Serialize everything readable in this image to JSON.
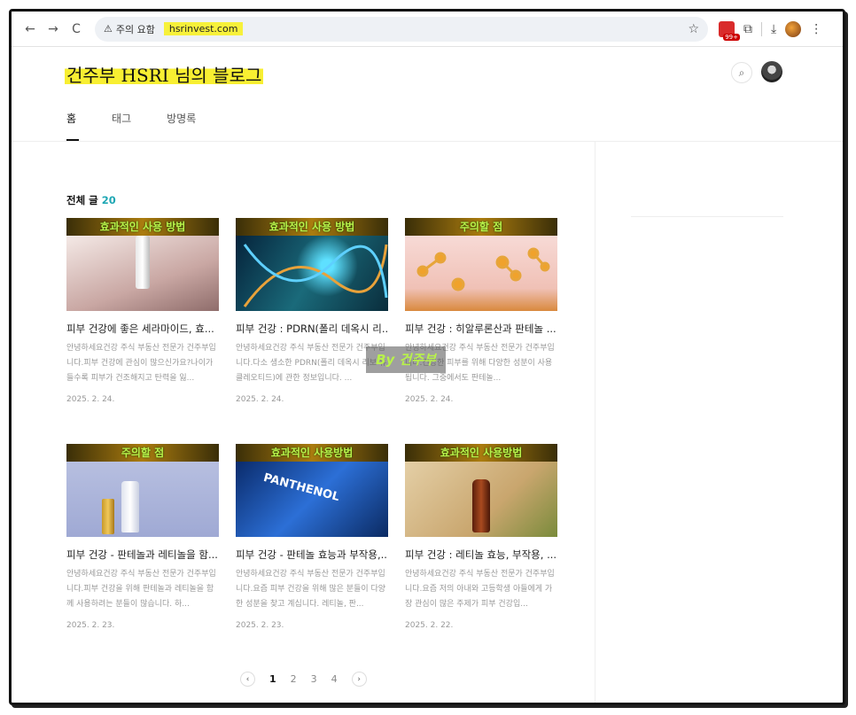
{
  "browser": {
    "nav_back": "←",
    "nav_forward": "→",
    "reload": "C",
    "warning_label": "주의 요함",
    "url": "hsrinvest.com",
    "star": "☆",
    "ext_badge": "99+",
    "ext_puzzle": "⧉",
    "download": "⤓",
    "menu": "⋮"
  },
  "blog": {
    "title": "건주부 HSRI 님의 블로그",
    "search_icon": "⌕",
    "menu": [
      {
        "label": "홈"
      },
      {
        "label": "태그"
      },
      {
        "label": "방명록"
      }
    ]
  },
  "posts_header": {
    "label": "전체 글",
    "count": "20"
  },
  "posts": [
    {
      "banner": "효과적인 사용 방법",
      "title": "피부 건강에 좋은 세라마이드, 효...",
      "excerpt": "안녕하세요건강 주식 부동산 전문가 건주부입니다.피부 건강에 관심이 많으신가요?나이가 들수록 피부가 건조해지고 탄력을 잃...",
      "date": "2025. 2. 24."
    },
    {
      "banner": "효과적인 사용 방법",
      "title": "피부 건강 : PDRN(폴리 데옥시 리...",
      "excerpt": "안녕하세요건강 주식 부동산 전문가 건주부입니다.다소 생소한 PDRN(폴리 데옥시 리보 뉴클레오티드)에 관한 정보입니다. ...",
      "date": "2025. 2. 24."
    },
    {
      "banner": "주의할 점",
      "title": "피부 건강 : 히알루론산과 판테놀 ...",
      "excerpt": "안녕하세요건강 주식 부동산 전문가 건주부입니다.건강한 피부를 위해 다양한 성분이 사용됩니다. 그중에서도 판테놀...",
      "date": "2025. 2. 24."
    },
    {
      "banner": "주의할 점",
      "title": "피부 건강 - 판테놀과 레티놀을 함...",
      "excerpt": "안녕하세요건강 주식 부동산 전문가 건주부입니다.피부 건강을 위해 판테놀과 레티놀을 함께 사용하려는 분들이 많습니다. 하...",
      "date": "2025. 2. 23."
    },
    {
      "banner": "효과적인 사용방법",
      "title": "피부 건강 - 판테놀 효능과 부작용,...",
      "excerpt": "안녕하세요건강 주식 부동산 전문가 건주부입니다.요즘 피부 건강을 위해 많은 분들이 다양한 성분을 찾고 계십니다. 레티놀, 판...",
      "date": "2025. 2. 23.",
      "thumb_text": "PANTHENOL"
    },
    {
      "banner": "효과적인 사용방법",
      "title": "피부 건강 : 레티놀 효능, 부작용, ...",
      "excerpt": "안녕하세요건강 주식 부동산 전문가 건주부입니다.요즘 저의 아내와 고등학생 아들에게 가장 관심이 많은 주제가 피부 건강입...",
      "date": "2025. 2. 22."
    }
  ],
  "watermark": "By 건주부",
  "pagination": {
    "prev": "‹",
    "pages": [
      "1",
      "2",
      "3",
      "4"
    ],
    "current": "1",
    "next": "›"
  },
  "colors": {
    "accent": "#1fa7b4",
    "highlight": "#f8ef32",
    "banner_text": "#b8f24a"
  }
}
